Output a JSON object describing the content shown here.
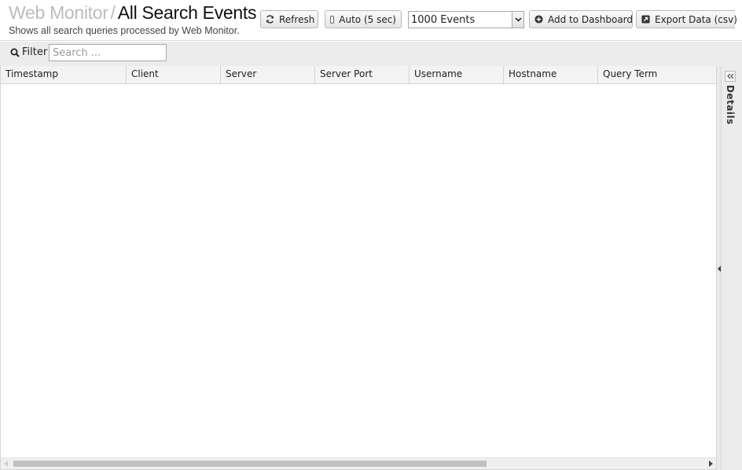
{
  "header": {
    "breadcrumb": "Web Monitor",
    "separator": "/",
    "title": "All Search Events",
    "subtitle": "Shows all search queries processed by Web Monitor."
  },
  "toolbar": {
    "refresh_label": "Refresh",
    "auto_label": "Auto (5 sec)",
    "events_selected": "1000 Events",
    "add_dashboard_label": "Add to Dashboard",
    "export_label": "Export Data (csv)"
  },
  "filter": {
    "label": "Filter",
    "placeholder": "Search ..."
  },
  "grid": {
    "columns": [
      "Timestamp",
      "Client",
      "Server",
      "Server Port",
      "Username",
      "Hostname",
      "Query Term"
    ],
    "rows": []
  },
  "details": {
    "label": "Details"
  }
}
